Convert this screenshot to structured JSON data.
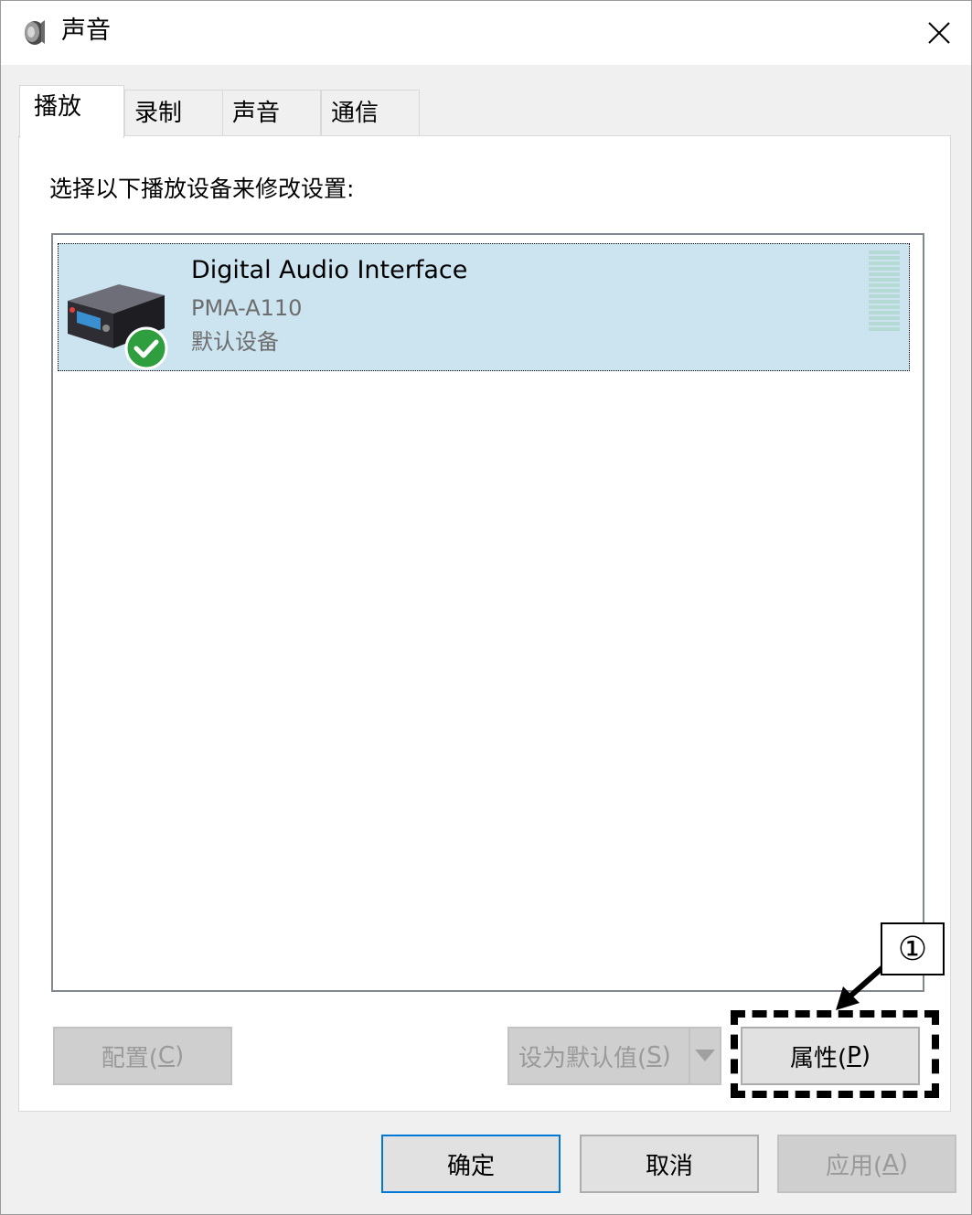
{
  "window": {
    "title": "声音",
    "title_icon": "speaker-icon",
    "close_icon": "close-icon"
  },
  "tabs": [
    {
      "label": "播放",
      "active": true
    },
    {
      "label": "录制",
      "active": false
    },
    {
      "label": "声音",
      "active": false
    },
    {
      "label": "通信",
      "active": false
    }
  ],
  "playback": {
    "instruction": "选择以下播放设备来修改设置:",
    "devices": [
      {
        "name": "Digital Audio Interface",
        "model": "PMA-A110",
        "status": "默认设备",
        "icon": "audio-device-icon",
        "badge_icon": "check-circle-icon",
        "selected": true
      }
    ]
  },
  "buttons": {
    "configure": {
      "prefix": "配置(",
      "key": "C",
      "suffix": ")",
      "enabled": false
    },
    "set_default": {
      "prefix": "设为默认值(",
      "key": "S",
      "suffix": ")",
      "enabled": false
    },
    "properties": {
      "prefix": "属性(",
      "key": "P",
      "suffix": ")",
      "enabled": true
    },
    "ok": {
      "label": "确定",
      "enabled": true
    },
    "cancel": {
      "label": "取消",
      "enabled": true
    },
    "apply": {
      "prefix": "应用(",
      "key": "A",
      "suffix": ")",
      "enabled": false
    }
  },
  "annotation": {
    "step": "①"
  },
  "colors": {
    "selection": "#cce4f0",
    "focus_border": "#0078d7",
    "check_green": "#2e9e3e",
    "meter": "#b5dad6"
  }
}
